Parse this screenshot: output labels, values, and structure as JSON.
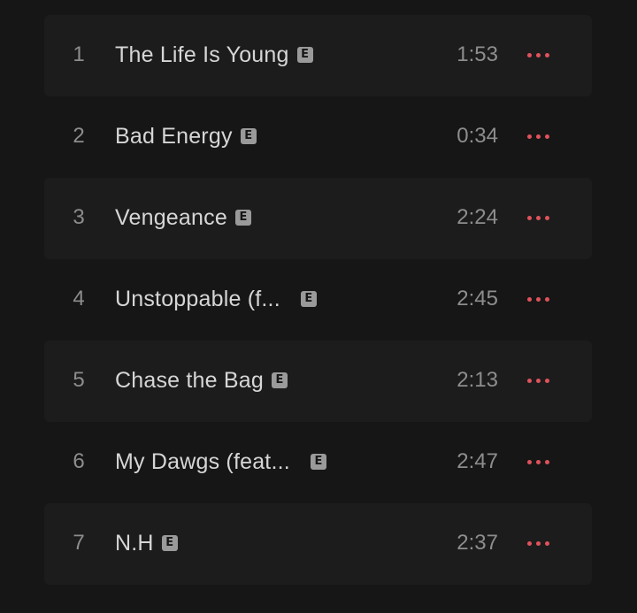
{
  "tracklist": {
    "tracks": [
      {
        "number": "1",
        "title": "The Life Is Young",
        "badge": "E",
        "duration": "1:53"
      },
      {
        "number": "2",
        "title": "Bad Energy",
        "badge": "E",
        "duration": "0:34"
      },
      {
        "number": "3",
        "title": "Vengeance",
        "badge": "E",
        "duration": "2:24"
      },
      {
        "number": "4",
        "title": "Unstoppable (f...",
        "badge": "E",
        "duration": "2:45"
      },
      {
        "number": "5",
        "title": "Chase the Bag",
        "badge": "E",
        "duration": "2:13"
      },
      {
        "number": "6",
        "title": "My Dawgs (feat...",
        "badge": "E",
        "duration": "2:47"
      },
      {
        "number": "7",
        "title": "N.H",
        "badge": "E",
        "duration": "2:37"
      }
    ],
    "more_icon": "more-horizontal-icon",
    "accent_color": "#e0525c"
  }
}
